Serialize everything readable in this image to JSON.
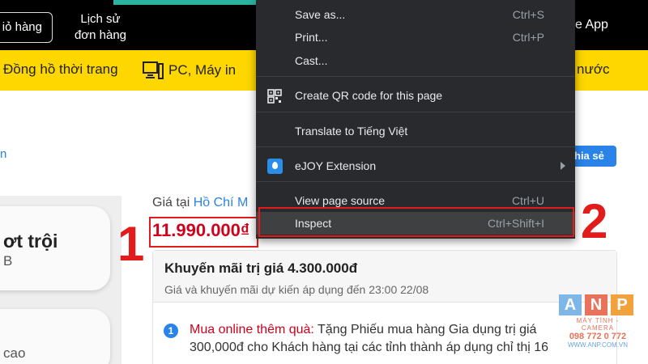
{
  "header": {
    "cart_label": "iỏ hàng",
    "orders_line1": "Lịch sử",
    "orders_line2": "đơn hàng",
    "app_label": "e App"
  },
  "nav": {
    "watch": "Đồng hồ thời trang",
    "pc": "PC, Máy in",
    "right": "nước"
  },
  "breadcrumb": {
    "link": "n"
  },
  "share_label": "hia sẻ",
  "gallery": {
    "card1_title": "ơt trội",
    "card1_sub": "B",
    "card2_text": "cao"
  },
  "price": {
    "location_prefix": "Giá tại",
    "city": "Hồ Chí M",
    "value": "11.990.000₫"
  },
  "promo": {
    "title": "Khuyến mãi trị giá 4.300.000đ",
    "subtitle": "Giá và khuyến mãi dự kiến áp dụng đến 23:00 22/08",
    "item_number": "1",
    "item_highlight": "Mua online thêm quà:",
    "item_text": " Tặng Phiếu mua hàng Gia dụng trị giá 300,000đ cho Khách hàng tại các tỉnh thành áp dụng chỉ thị 16"
  },
  "context_menu": {
    "items": [
      {
        "label": "Save as...",
        "shortcut": "Ctrl+S"
      },
      {
        "label": "Print...",
        "shortcut": "Ctrl+P"
      },
      {
        "label": "Cast...",
        "shortcut": ""
      },
      {
        "label": "Create QR code for this page",
        "shortcut": "",
        "icon": "qr-code-icon"
      },
      {
        "label": "Translate to Tiếng Việt",
        "shortcut": ""
      },
      {
        "label": "eJOY Extension",
        "shortcut": "",
        "icon": "ejoy-icon"
      },
      {
        "label": "View page source",
        "shortcut": "Ctrl+U"
      },
      {
        "label": "Inspect",
        "shortcut": "Ctrl+Shift+I"
      }
    ]
  },
  "annotations": {
    "step1": "1",
    "step2": "2",
    "color": "#e21b1b"
  },
  "logo": {
    "letters": [
      "A",
      "N",
      "P"
    ],
    "tagline": "MÁY TÍNH - CAMERA",
    "phone": "098 772 0 772",
    "site": "WWW.ANP.COM.VN"
  }
}
